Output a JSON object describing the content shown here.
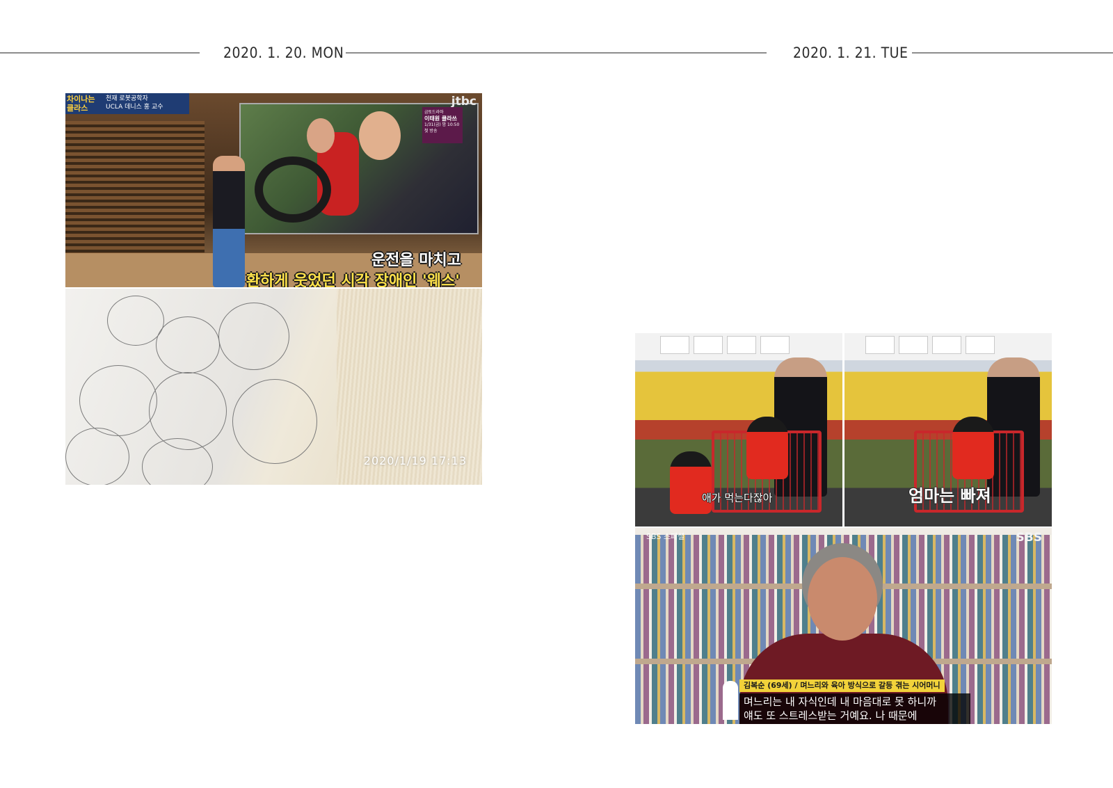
{
  "dates": {
    "left": "2020. 1. 20. MON",
    "right": "2020. 1. 21. TUE"
  },
  "tv_jtbc": {
    "show_logo": "차이나는 클라스",
    "ticker_line1": "천재 로봇공학자",
    "ticker_line2": "UCLA 데니스 홍 교수",
    "channel_logo": "jtbc",
    "promo_label": "금토드라마",
    "promo_title": "이태원 클라쓰",
    "promo_time": "1/31(금) 밤 10:50",
    "promo_note": "첫 방송",
    "caption_line1": "운전을 마치고",
    "caption_line2": "환하게 웃었던 시각 장애인 '웨스'"
  },
  "fabric_photo": {
    "timestamp": "2020/1/19   17:13"
  },
  "market_frame_1": {
    "subtitle": "애가 먹는다잖아"
  },
  "market_frame_2": {
    "subtitle": "엄마는 빠져"
  },
  "sbs_interview": {
    "channel_logo": "SBS",
    "program_logo": "SBS 스페셜",
    "name_tag": "김복순 (69세) / 며느리와 육아 방식으로 갈등 겪는 시어머니",
    "quote": "며느리는 내 자식인데 내 마음대로 못 하니까\n얘도 또 스트레스받는 거예요. 나 때문에"
  },
  "colors": {
    "rule": "#8c8c8c",
    "date_text": "#2b2b2b",
    "caption_yellow": "#ffe24a",
    "sbs_namebar": "#f2d23a"
  }
}
